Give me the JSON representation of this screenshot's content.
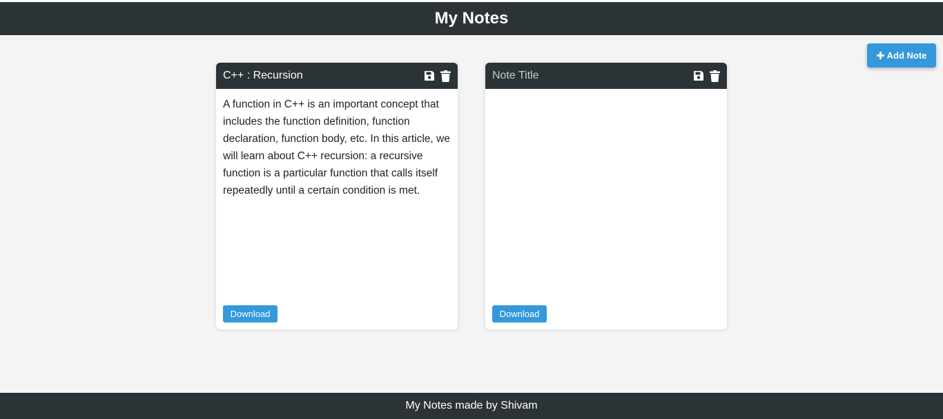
{
  "app": {
    "title": "My Notes"
  },
  "toolbar": {
    "add_note_label": "Add Note",
    "add_icon": "plus-icon"
  },
  "notes": [
    {
      "title": "C++ : Recursion",
      "body": "A function in C++ is an important concept that includes the function definition, function declaration, function body, etc. In this article, we will learn about C++ recursion: a recursive function is a particular function that calls itself repeatedly until a certain condition is met.",
      "download_label": "Download",
      "icons": [
        "save-icon",
        "trash-icon"
      ]
    },
    {
      "title": "",
      "title_placeholder": "Note Title",
      "body": "",
      "download_label": "Download",
      "icons": [
        "save-icon",
        "trash-icon"
      ]
    }
  ],
  "footer": {
    "text": "My Notes made by Shivam"
  },
  "colors": {
    "header_bg": "#2c3337",
    "accent": "#3498db",
    "page_bg": "#f4f4f4"
  }
}
